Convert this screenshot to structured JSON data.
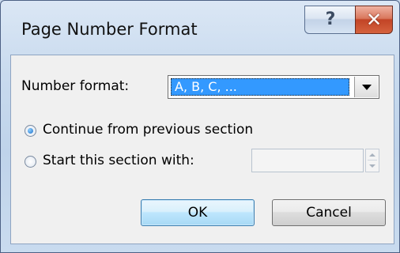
{
  "window": {
    "title": "Page Number Format",
    "help_icon": "question-mark-icon",
    "close_icon": "close-x-icon"
  },
  "number_format": {
    "label": "Number format:",
    "selected_value": "A, B, C, ...",
    "dropdown_icon": "chevron-down-icon"
  },
  "numbering": {
    "continue_label": "Continue from previous section",
    "continue_selected": true,
    "start_label": "Start this section with:",
    "start_selected": false,
    "start_value": ""
  },
  "buttons": {
    "ok_label": "OK",
    "cancel_label": "Cancel"
  },
  "colors": {
    "selection": "#3399ff",
    "close_button": "#c24426"
  }
}
